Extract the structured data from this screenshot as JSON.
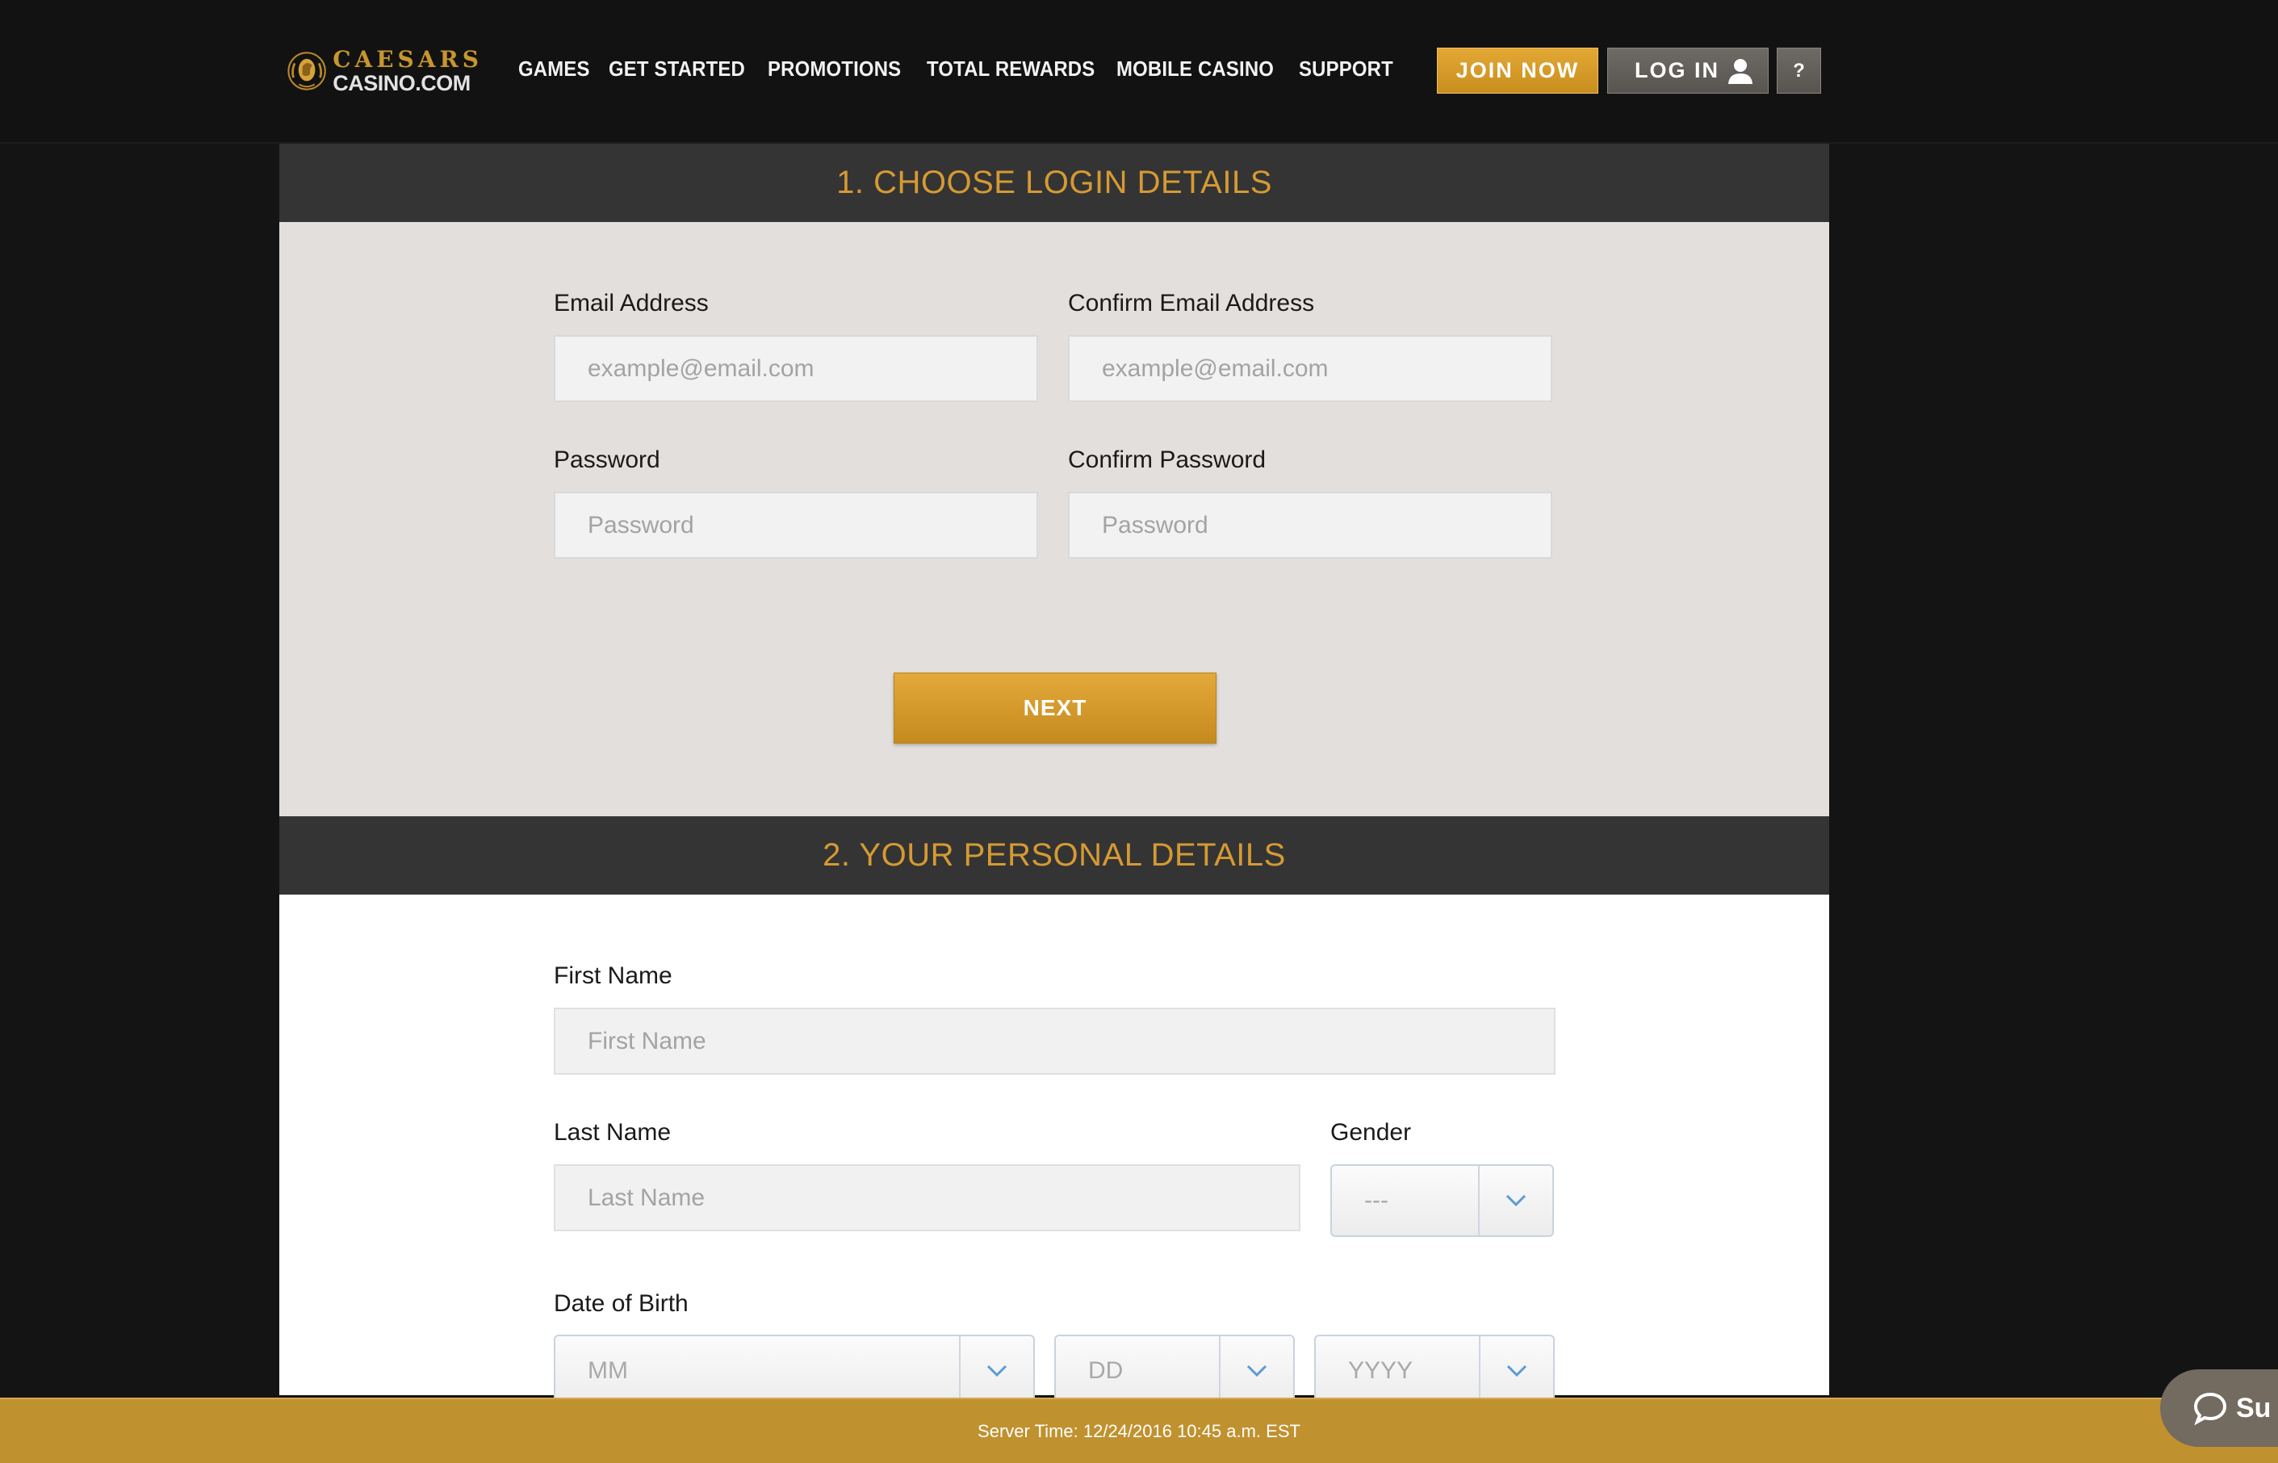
{
  "brand": {
    "logo_line1": "CAESARS",
    "logo_line2": "CASINO.COM",
    "accent": "#c8962e"
  },
  "nav": {
    "items": [
      {
        "label": "GAMES"
      },
      {
        "label": "GET STARTED"
      },
      {
        "label": "PROMOTIONS"
      },
      {
        "label": "TOTAL REWARDS"
      },
      {
        "label": "MOBILE CASINO"
      },
      {
        "label": "SUPPORT"
      }
    ],
    "join_label": "JOIN NOW",
    "login_label": "LOG IN",
    "help_label": "?",
    "login_icon": "user-icon"
  },
  "section1": {
    "title": "1. CHOOSE LOGIN DETAILS",
    "email_label": "Email Address",
    "email_placeholder": "example@email.com",
    "confirm_email_label": "Confirm Email Address",
    "confirm_email_placeholder": "example@email.com",
    "password_label": "Password",
    "password_placeholder": "Password",
    "confirm_password_label": "Confirm Password",
    "confirm_password_placeholder": "Password",
    "next_label": "NEXT"
  },
  "section2": {
    "title": "2. YOUR PERSONAL DETAILS",
    "first_name_label": "First Name",
    "first_name_placeholder": "First Name",
    "last_name_label": "Last Name",
    "last_name_placeholder": "Last Name",
    "gender_label": "Gender",
    "gender_value": "---",
    "dob_label": "Date of Birth",
    "dob_month": "MM",
    "dob_day": "DD",
    "dob_year": "YYYY"
  },
  "footer": {
    "server_time": "Server Time: 12/24/2016 10:45 a.m. EST",
    "support_label": "Su",
    "support_icon": "chat-bubble-icon"
  }
}
